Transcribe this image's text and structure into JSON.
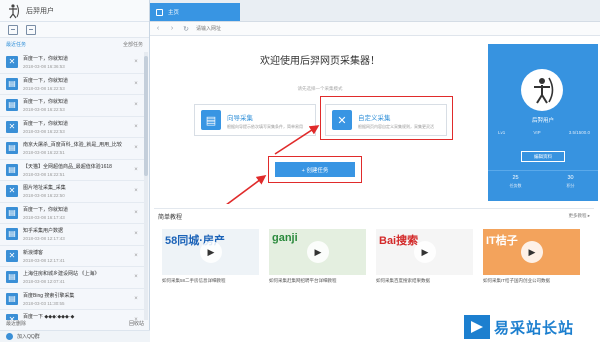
{
  "app": {
    "user_label": "后羿用户"
  },
  "sidebar": {
    "section_title": "最近任务",
    "section_action": "全部任务",
    "tasks": [
      {
        "title": "百度一下，你就知道",
        "meta": "2018-03-08 16:36:53"
      },
      {
        "title": "百度一下，你就知道",
        "meta": "2018-03-08 16:22:53"
      },
      {
        "title": "百度一下，你就知道",
        "meta": "2018-03-08 16:22:53"
      },
      {
        "title": "百度一下，你就知道",
        "meta": "2018-03-08 16:22:53"
      },
      {
        "title": "南京大屠杀_百度百科_体验_就是_用用_比较",
        "meta": "2018-03-08 16:22:51"
      },
      {
        "title": "【天猫】全网超值商品_最超值体验1618",
        "meta": "2018-03-08 16:22:51"
      },
      {
        "title": "图片地址采集_采集",
        "meta": "2018-03-08 16:22:50"
      },
      {
        "title": "百度一下，你就知道",
        "meta": "2018-03-08 16:17:43"
      },
      {
        "title": "知乎采集用户数据",
        "meta": "2018-03-08 12:17:43"
      },
      {
        "title": "新浪博客",
        "meta": "2018-03-08 12:17:41"
      },
      {
        "title": "上海住房和城乡建设网站 《上海》",
        "meta": "2018-03-08 12:07:41"
      },
      {
        "title": "百度Bing 搜索引擎采集",
        "meta": "2018-03-03 11:30:55"
      },
      {
        "title": "百度一下 ◆◆◆:◆◆◆·◆",
        "meta": "2018-02-28 16:54:18"
      }
    ],
    "footer_left": "最近删除",
    "footer_right": "回收站",
    "bottom_label": "加入QQ群"
  },
  "browser": {
    "tab_label": "主页",
    "url_placeholder": "请输入网址"
  },
  "welcome": {
    "title": "欢迎使用后羿网页采集器！",
    "subtitle": "请先选择一个采集模式",
    "wizard": {
      "name": "向导采集",
      "desc": "根据向导提示依次填写采集条件，简单易用"
    },
    "custom": {
      "name": "自定义采集",
      "desc": "根据网页内容自定义采集规则，采集更灵活"
    },
    "create_button": "+ 创建任务"
  },
  "profile": {
    "name": "后羿用户",
    "stat_left": "Lv1",
    "stat_mid": "VIP",
    "stat_right": "3.5/1500.0",
    "edit_button": "编辑资料",
    "count_left_num": "25",
    "count_left_label": "任务数",
    "count_right_num": "30",
    "count_right_label": "积分"
  },
  "tutorials": {
    "title": "简单教程",
    "more": "更多教程 ▸",
    "items": [
      {
        "thumb_text": "58同城·房产",
        "caption": "如何采集58二手房信息详细教程"
      },
      {
        "thumb_text": "ganji",
        "caption": "如何采集赶集网招聘平台详细教程"
      },
      {
        "thumb_text": "Bai搜索",
        "caption": "如何采集百度搜索结果数据"
      },
      {
        "thumb_text": "IT桔子",
        "caption": "如何采集IT桔子国内创业公司数据"
      }
    ]
  },
  "watermark": {
    "text": "易采站长站"
  },
  "colors": {
    "accent": "#3895e3",
    "highlight": "#e02b2b",
    "profile_bg": "#3793e0"
  }
}
